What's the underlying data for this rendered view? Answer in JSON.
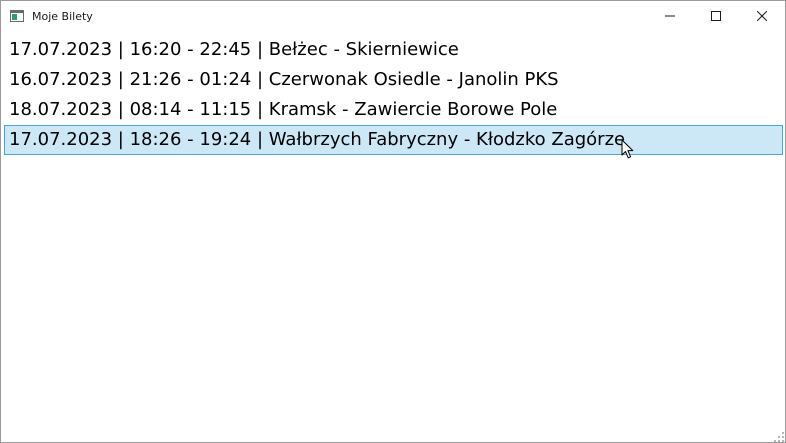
{
  "window": {
    "title": "Moje Bilety",
    "app_icon": "window-app-icon"
  },
  "caption_buttons": {
    "minimize_icon": "minimize-icon",
    "maximize_icon": "maximize-icon",
    "close_icon": "close-icon"
  },
  "tickets": {
    "items": [
      {
        "text": "17.07.2023 | 16:20 - 22:45 | Bełżec - Skierniewice",
        "selected": false
      },
      {
        "text": "16.07.2023 | 21:26 - 01:24 | Czerwonak Osiedle - Janolin PKS",
        "selected": false
      },
      {
        "text": "18.07.2023 | 08:14 - 11:15 | Kramsk - Zawiercie Borowe Pole",
        "selected": false
      },
      {
        "text": "17.07.2023 | 18:26 - 19:24 | Wałbrzych Fabryczny - Kłodzko Zagórze",
        "selected": true
      }
    ]
  },
  "colors": {
    "selection_background": "#cce8f6",
    "selection_border": "#49a4d8",
    "window_border": "#9a9a9a",
    "text": "#000000"
  }
}
